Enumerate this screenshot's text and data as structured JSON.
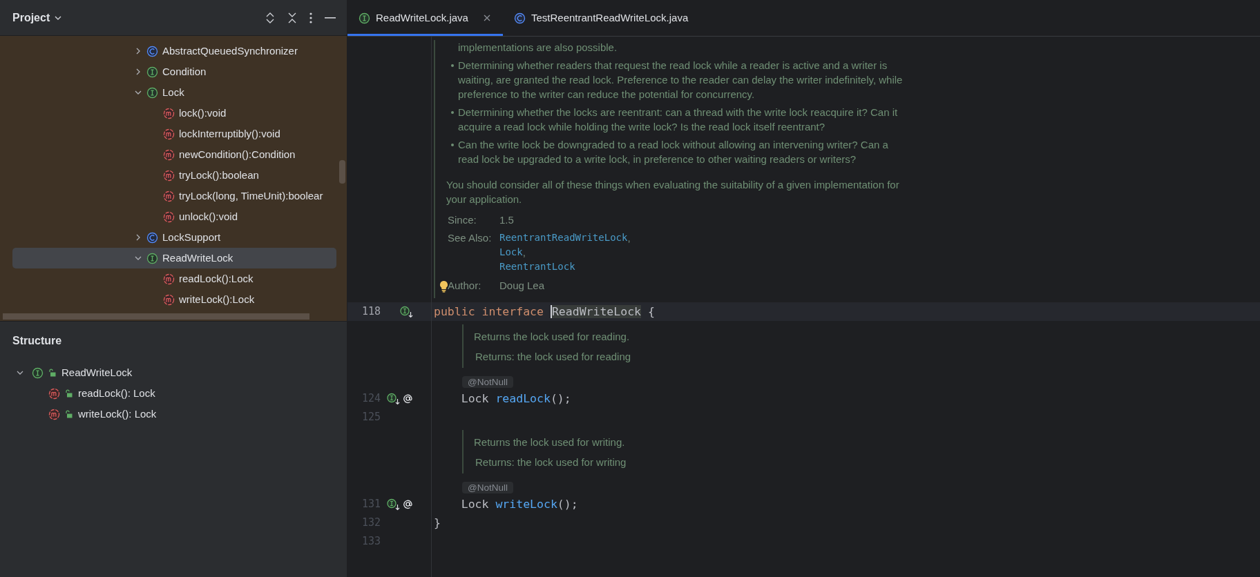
{
  "project_panel": {
    "title": "Project",
    "tree": [
      {
        "label": "AbstractQueuedSynchronizer",
        "kind": "class",
        "expanded": false,
        "selected": false
      },
      {
        "label": "Condition",
        "kind": "interface",
        "expanded": false,
        "selected": false
      },
      {
        "label": "Lock",
        "kind": "interface",
        "expanded": true,
        "selected": false,
        "children": [
          {
            "label": "lock():void",
            "kind": "method",
            "selected": false
          },
          {
            "label": "lockInterruptibly():void",
            "kind": "method",
            "selected": false
          },
          {
            "label": "newCondition():Condition",
            "kind": "method",
            "selected": false
          },
          {
            "label": "tryLock():boolean",
            "kind": "method",
            "selected": false
          },
          {
            "label": "tryLock(long, TimeUnit):boolear",
            "kind": "method",
            "selected": false
          },
          {
            "label": "unlock():void",
            "kind": "method",
            "selected": false
          }
        ]
      },
      {
        "label": "LockSupport",
        "kind": "class",
        "expanded": false,
        "selected": false
      },
      {
        "label": "ReadWriteLock",
        "kind": "interface",
        "expanded": true,
        "selected": true,
        "children": [
          {
            "label": "readLock():Lock",
            "kind": "method",
            "selected": false
          },
          {
            "label": "writeLock():Lock",
            "kind": "method",
            "selected": false
          }
        ]
      }
    ]
  },
  "structure_panel": {
    "title": "Structure",
    "tree": [
      {
        "label": "ReadWriteLock",
        "kind": "interface",
        "expanded": true,
        "children": [
          {
            "label": "readLock(): Lock",
            "kind": "method"
          },
          {
            "label": "writeLock(): Lock",
            "kind": "method"
          }
        ]
      }
    ]
  },
  "tabs": [
    {
      "label": "ReadWriteLock.java",
      "kind": "interface",
      "selected": true,
      "closable": true
    },
    {
      "label": "TestReentrantReadWriteLock.java",
      "kind": "class",
      "selected": false,
      "closable": false
    }
  ],
  "doc": {
    "items": [
      {
        "bullet": false,
        "lines": [
          "implementations are also possible."
        ]
      },
      {
        "bullet": true,
        "lines": [
          "Determining whether readers that request the read lock while a reader is active and a writer is",
          "waiting, are granted the read lock. Preference to the reader can delay the writer indefinitely, while",
          "preference to the writer can reduce the potential for concurrency."
        ]
      },
      {
        "bullet": true,
        "lines": [
          "Determining whether the locks are reentrant: can a thread with the write lock reacquire it? Can it",
          "acquire a read lock while holding the write lock? Is the read lock itself reentrant?"
        ]
      },
      {
        "bullet": true,
        "lines": [
          "Can the write lock be downgraded to a read lock without allowing an intervening writer? Can a",
          "read lock be upgraded to a write lock, in preference to other waiting readers or writers?"
        ]
      }
    ],
    "paragraph": [
      "You should consider all of these things when evaluating the suitability of a given implementation for",
      "your application."
    ],
    "tags": [
      {
        "label": "Since:",
        "values": [
          {
            "text": "1.5",
            "kind": "text"
          }
        ]
      },
      {
        "label": "See Also:",
        "values": [
          {
            "text": "ReentrantReadWriteLock",
            "kind": "link",
            "suffix": ","
          },
          {
            "text": "Lock",
            "kind": "link",
            "suffix": ","
          },
          {
            "text": "ReentrantLock",
            "kind": "link"
          }
        ]
      },
      {
        "label": "Author:",
        "bulb": true,
        "values": [
          {
            "text": "Doug Lea",
            "kind": "text"
          }
        ]
      }
    ]
  },
  "code": [
    {
      "kind": "code",
      "number": "118",
      "current": true,
      "implemented_marker": true,
      "annotation_marker": false,
      "tokens": [
        {
          "text": "public interface ",
          "kind": "keyword"
        },
        {
          "text": "ReadWriteLock",
          "kind": "caret_identifier"
        },
        {
          "text": " {",
          "kind": "plain"
        }
      ]
    },
    {
      "kind": "doc",
      "lines": [
        "Returns the lock used for reading.",
        "Returns: the lock used for reading"
      ]
    },
    {
      "kind": "inlay",
      "text": "@NotNull"
    },
    {
      "kind": "code",
      "number": "124",
      "current": false,
      "implemented_marker": true,
      "annotation_marker": true,
      "tokens": [
        {
          "text": "    Lock ",
          "kind": "plain"
        },
        {
          "text": "readLock",
          "kind": "method"
        },
        {
          "text": "();",
          "kind": "plain"
        }
      ]
    },
    {
      "kind": "code",
      "number": "125",
      "current": false
    },
    {
      "kind": "doc",
      "lines": [
        "Returns the lock used for writing.",
        "Returns: the lock used for writing"
      ]
    },
    {
      "kind": "inlay",
      "text": "@NotNull"
    },
    {
      "kind": "code",
      "number": "131",
      "current": false,
      "implemented_marker": true,
      "annotation_marker": true,
      "tokens": [
        {
          "text": "    Lock ",
          "kind": "plain"
        },
        {
          "text": "writeLock",
          "kind": "method"
        },
        {
          "text": "();",
          "kind": "plain"
        }
      ]
    },
    {
      "kind": "code",
      "number": "132",
      "current": false,
      "tokens": [
        {
          "text": "}",
          "kind": "plain"
        }
      ]
    },
    {
      "kind": "code",
      "number": "133",
      "current": false
    }
  ]
}
